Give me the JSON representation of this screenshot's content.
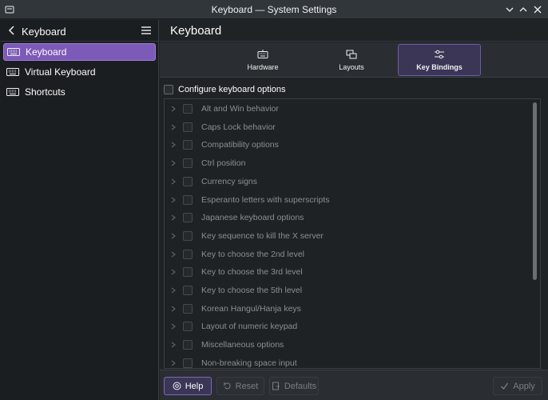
{
  "window": {
    "title": "Keyboard — System Settings"
  },
  "sidebar": {
    "title": "Keyboard",
    "items": [
      {
        "label": "Keyboard",
        "active": true
      },
      {
        "label": "Virtual Keyboard",
        "active": false
      },
      {
        "label": "Shortcuts",
        "active": false
      }
    ]
  },
  "main": {
    "title": "Keyboard",
    "tabs": [
      {
        "label": "Hardware",
        "icon": "keyboard-icon"
      },
      {
        "label": "Layouts",
        "icon": "layouts-icon"
      },
      {
        "label": "Key Bindings",
        "icon": "sliders-icon",
        "active": true
      }
    ],
    "configure_label": "Configure keyboard options",
    "options": [
      "Alt and Win behavior",
      "Caps Lock behavior",
      "Compatibility options",
      "Ctrl position",
      "Currency signs",
      "Esperanto letters with superscripts",
      "Japanese keyboard options",
      "Key sequence to kill the X server",
      "Key to choose the 2nd level",
      "Key to choose the 3rd level",
      "Key to choose the 5th level",
      "Korean Hangul/Hanja keys",
      "Layout of numeric keypad",
      "Miscellaneous options",
      "Non-breaking space input"
    ]
  },
  "footer": {
    "help": "Help",
    "reset": "Reset",
    "defaults": "Defaults",
    "apply": "Apply"
  },
  "colors": {
    "accent": "#7c5ab8",
    "background": "#202326",
    "sidebar": "#1b1e20"
  }
}
